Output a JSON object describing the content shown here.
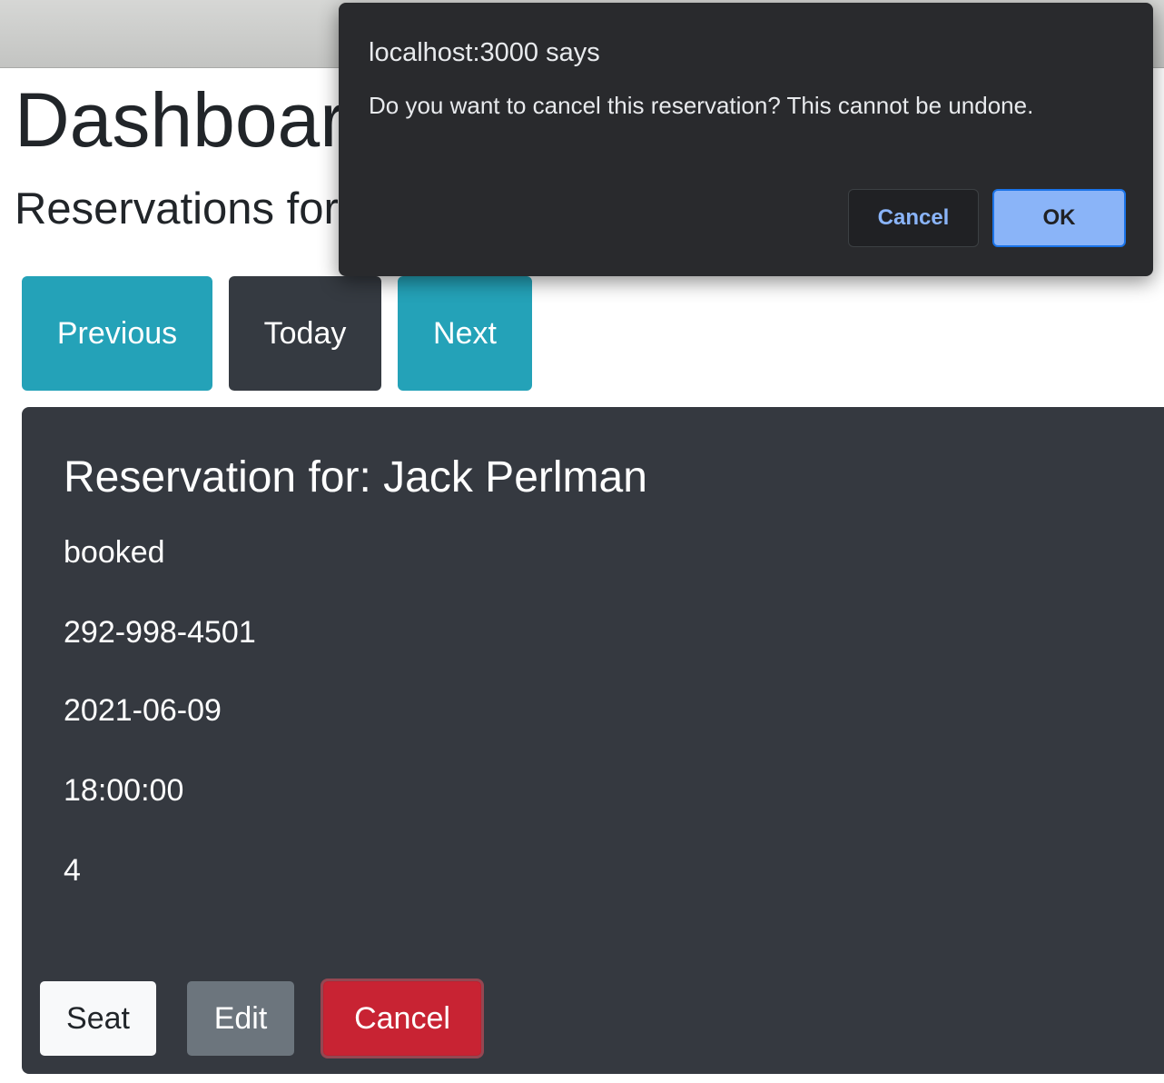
{
  "page": {
    "title": "Dashboard",
    "subtitle": "Reservations for"
  },
  "date_nav": {
    "previous_label": "Previous",
    "today_label": "Today",
    "next_label": "Next"
  },
  "reservation": {
    "title": "Reservation for: Jack Perlman",
    "status": "booked",
    "mobile_number": "292-998-4501",
    "date": "2021-06-09",
    "time": "18:00:00",
    "people": "4",
    "actions": {
      "seat_label": "Seat",
      "edit_label": "Edit",
      "cancel_label": "Cancel"
    }
  },
  "confirm_dialog": {
    "title": "localhost:3000 says",
    "message": "Do you want to cancel this reservation? This cannot be undone.",
    "cancel_label": "Cancel",
    "ok_label": "OK"
  },
  "colors": {
    "info_button": "#24a2b8",
    "dark_button": "#353a41",
    "card_background": "#353940",
    "danger_button": "#c82333",
    "secondary_button": "#6c757d",
    "dialog_background": "#292a2d",
    "dialog_accent": "#8ab4f8"
  }
}
